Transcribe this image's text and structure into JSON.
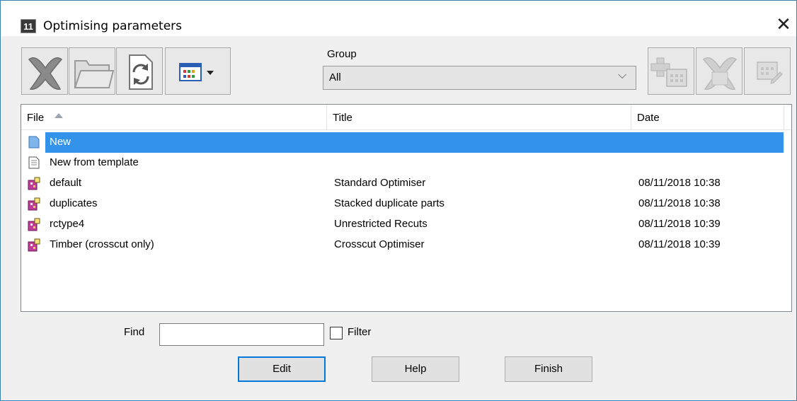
{
  "window": {
    "app_icon_text": "11",
    "title": "Optimising parameters",
    "close_glyph": "✕"
  },
  "toolbar_left": [
    {
      "name": "delete-icon",
      "enabled": false
    },
    {
      "name": "folder-open-icon",
      "enabled": false
    },
    {
      "name": "refresh-icon",
      "enabled": true
    },
    {
      "name": "view-options-icon",
      "enabled": true
    }
  ],
  "group": {
    "label": "Group",
    "value": "All"
  },
  "toolbar_right": [
    {
      "name": "add-group-icon",
      "enabled": false
    },
    {
      "name": "delete-group-icon",
      "enabled": false
    },
    {
      "name": "edit-group-icon",
      "enabled": false
    }
  ],
  "list": {
    "columns": [
      "File",
      "Title",
      "Date"
    ],
    "sort_column": "File",
    "sort_direction": "ascending",
    "rows": [
      {
        "icon": "new-document-icon",
        "file": "New",
        "title": "",
        "date": "",
        "selected": true
      },
      {
        "icon": "template-document-icon",
        "file": "New from template",
        "title": "",
        "date": "",
        "selected": false
      },
      {
        "icon": "parameter-file-icon",
        "file": "default",
        "title": "Standard Optimiser",
        "date": "08/11/2018  10:38",
        "selected": false
      },
      {
        "icon": "parameter-file-icon",
        "file": "duplicates",
        "title": "Stacked duplicate parts",
        "date": "08/11/2018  10:38",
        "selected": false
      },
      {
        "icon": "parameter-file-icon",
        "file": "rctype4",
        "title": "Unrestricted Recuts",
        "date": "08/11/2018  10:39",
        "selected": false
      },
      {
        "icon": "parameter-file-icon",
        "file": "Timber (crosscut only)",
        "title": "Crosscut Optimiser",
        "date": "08/11/2018  10:39",
        "selected": false
      }
    ]
  },
  "find": {
    "label": "Find",
    "value": ""
  },
  "filter": {
    "label": "Filter",
    "checked": false
  },
  "buttons": {
    "edit": "Edit",
    "help": "Help",
    "finish": "Finish"
  },
  "colors": {
    "selection": "#3392ea",
    "window_border": "#3c7fb1",
    "default_button_border": "#0078d7"
  }
}
